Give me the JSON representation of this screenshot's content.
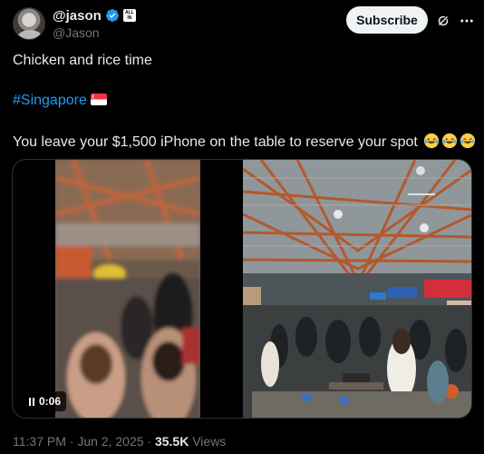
{
  "author": {
    "display_name": "@jason",
    "handle": "@Jason",
    "affiliation_badge": "ALL IN",
    "verified_icon": "verified-badge-icon"
  },
  "actions": {
    "subscribe_label": "Subscribe",
    "grok_icon": "grok-icon",
    "more_icon": "more-icon"
  },
  "tweet": {
    "line1": "Chicken and rice time",
    "hashtag": "#Singapore",
    "flag_emoji": "singapore-flag",
    "line3": "You leave your $1,500 iPhone on the table to reserve your spot",
    "trailing_emoji": "laughing-emoji x3"
  },
  "video": {
    "elapsed": "0:06",
    "state": "playing"
  },
  "meta": {
    "time": "11:37 PM",
    "date": "Jun 2, 2025",
    "sep": "·",
    "views_count": "35.5K",
    "views_label": "Views"
  },
  "colors": {
    "background": "#000000",
    "text": "#e7e9ea",
    "muted": "#71767b",
    "link": "#1d9bf0",
    "verified": "#1d9bf0"
  }
}
